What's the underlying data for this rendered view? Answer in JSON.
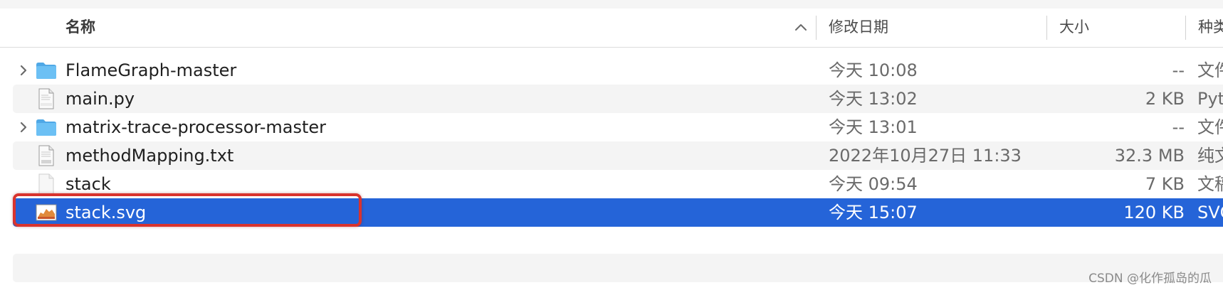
{
  "columns": {
    "name": "名称",
    "date": "修改日期",
    "size": "大小",
    "kind": "种类"
  },
  "files": [
    {
      "name": "FlameGraph-master",
      "date": "今天 10:08",
      "size": "--",
      "kind": "文件夹",
      "icon": "folder-icon",
      "expandable": true
    },
    {
      "name": "main.py",
      "date": "今天 13:02",
      "size": "2 KB",
      "kind": "Python",
      "icon": "python-file-icon",
      "expandable": false
    },
    {
      "name": "matrix-trace-processor-master",
      "date": "今天 13:01",
      "size": "--",
      "kind": "文件夹",
      "icon": "folder-icon",
      "expandable": true
    },
    {
      "name": "methodMapping.txt",
      "date": "2022年10月27日 11:33",
      "size": "32.3 MB",
      "kind": "纯文本",
      "icon": "txt-file-icon",
      "expandable": false
    },
    {
      "name": "stack",
      "date": "今天 09:54",
      "size": "7 KB",
      "kind": "文稿",
      "icon": "blank-file-icon",
      "expandable": false
    },
    {
      "name": "stack.svg",
      "date": "今天 15:07",
      "size": "120 KB",
      "kind": "SVG",
      "icon": "svg-file-icon",
      "expandable": false,
      "selected": true
    }
  ],
  "watermark": "CSDN @化作孤岛的瓜",
  "colors": {
    "selection": "#2564d8",
    "highlight_border": "#d8332e",
    "folder": "#5fb6ef",
    "alt_row": "#f4f4f4"
  }
}
